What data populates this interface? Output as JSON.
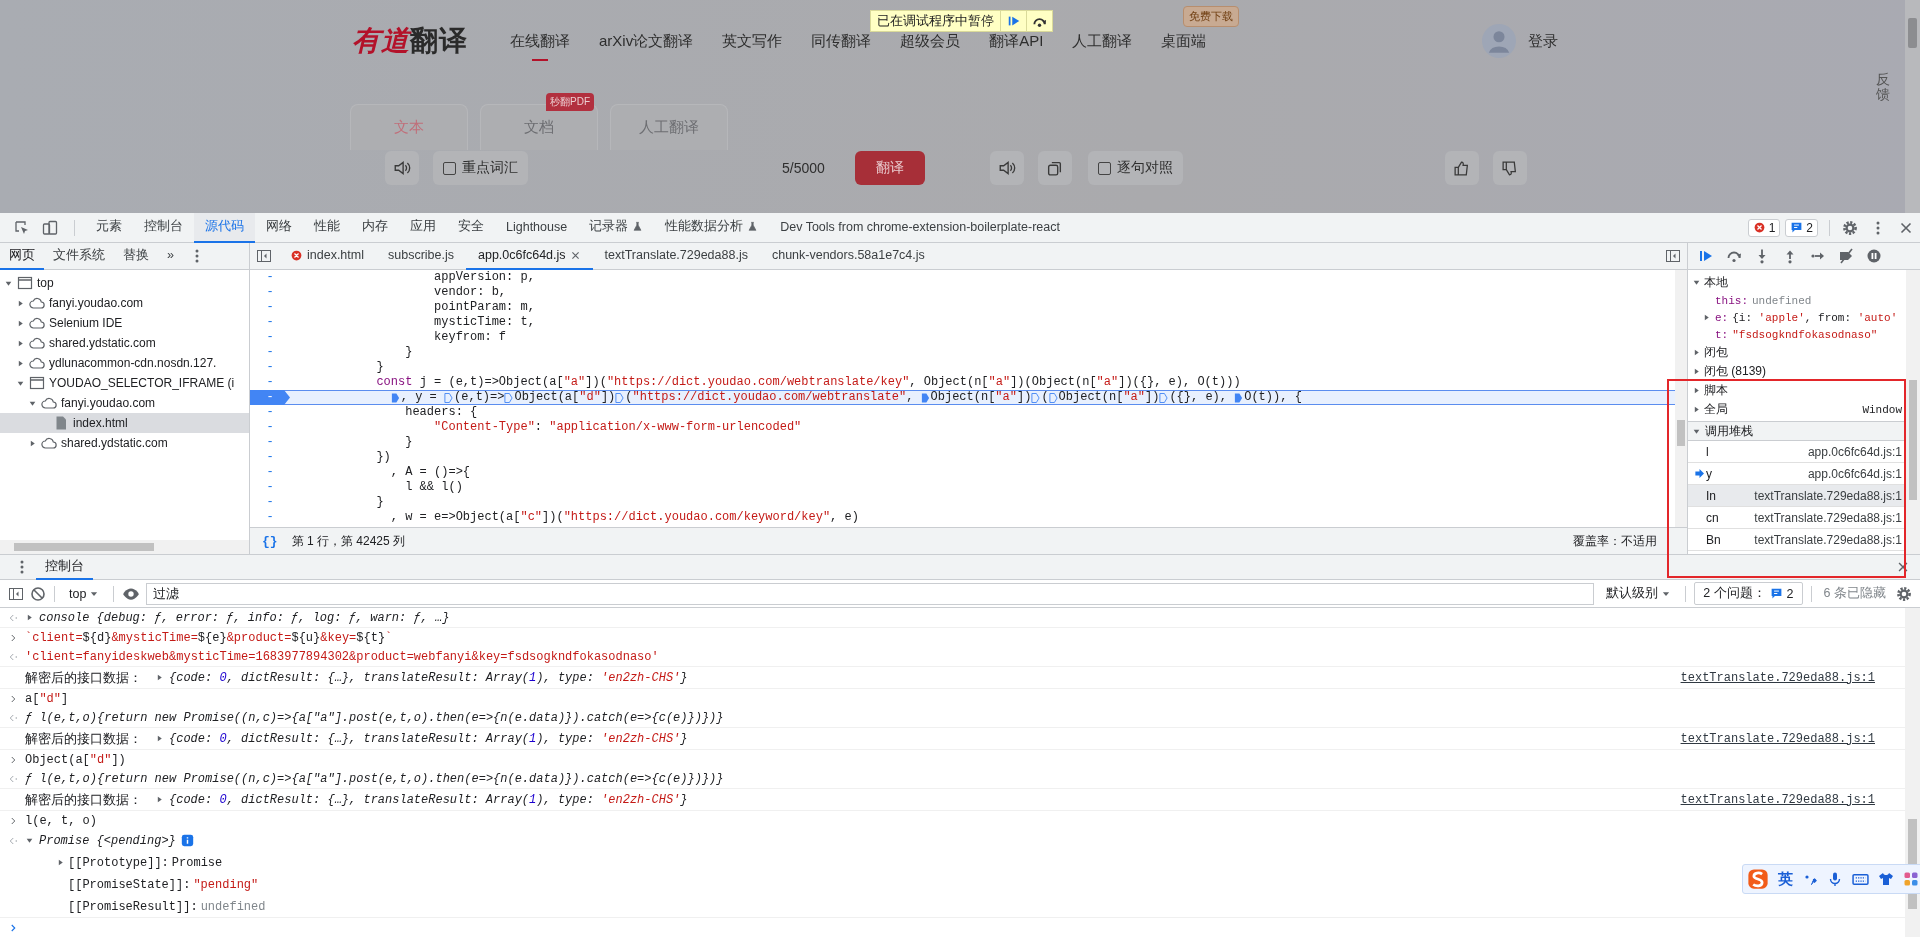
{
  "webpage": {
    "logo": {
      "brand": "有道",
      "word": "翻译"
    },
    "nav": [
      {
        "label": "在线翻译",
        "selected": true
      },
      {
        "label": "arXiv论文翻译",
        "selected": false
      },
      {
        "label": "英文写作",
        "selected": false
      },
      {
        "label": "同传翻译",
        "selected": false
      },
      {
        "label": "超级会员",
        "selected": false
      },
      {
        "label": "翻译API",
        "selected": false
      },
      {
        "label": "人工翻译",
        "selected": false
      },
      {
        "label": "桌面端",
        "selected": false,
        "badge": "免费下载"
      }
    ],
    "paused_banner": {
      "text": "已在调试程序中暂停"
    },
    "login": "登录",
    "feedback": "反馈",
    "mode_tabs": [
      {
        "label": "文本",
        "selected": true
      },
      {
        "label": "文档",
        "selected": false,
        "badge": "秒翻PDF"
      },
      {
        "label": "人工翻译",
        "selected": false
      }
    ],
    "toolbar": {
      "key_words": {
        "label": "重点词汇",
        "checked": false
      },
      "count": "5/5000",
      "translate_button": "翻译",
      "compare": {
        "label": "逐句对照",
        "checked": false
      }
    }
  },
  "devtools": {
    "tabs": [
      {
        "label": "元素",
        "selected": false,
        "experimental": false
      },
      {
        "label": "控制台",
        "selected": false,
        "experimental": false
      },
      {
        "label": "源代码",
        "selected": true,
        "experimental": false
      },
      {
        "label": "网络",
        "selected": false,
        "experimental": false
      },
      {
        "label": "性能",
        "selected": false,
        "experimental": false
      },
      {
        "label": "内存",
        "selected": false,
        "experimental": false
      },
      {
        "label": "应用",
        "selected": false,
        "experimental": false
      },
      {
        "label": "安全",
        "selected": false,
        "experimental": false
      },
      {
        "label": "Lighthouse",
        "selected": false,
        "experimental": false
      },
      {
        "label": "记录器",
        "selected": false,
        "experimental": true
      },
      {
        "label": "性能数据分析",
        "selected": false,
        "experimental": true
      },
      {
        "label": "Dev Tools from chrome-extension-boilerplate-react",
        "selected": false,
        "experimental": false
      }
    ],
    "counters": {
      "errors": "1",
      "issues": "2"
    },
    "navigator": {
      "tabs": [
        {
          "label": "网页",
          "selected": true
        },
        {
          "label": "文件系统",
          "selected": false
        },
        {
          "label": "替换",
          "selected": false
        }
      ],
      "more": "»",
      "tree": [
        {
          "label": "top",
          "kind": "frame",
          "expanded": true,
          "selected": false,
          "children": [
            {
              "label": "fanyi.youdao.com",
              "kind": "domain",
              "expanded": false,
              "selected": false
            },
            {
              "label": "Selenium IDE",
              "kind": "domain",
              "expanded": false,
              "selected": false
            },
            {
              "label": "shared.ydstatic.com",
              "kind": "domain",
              "expanded": false,
              "selected": false
            },
            {
              "label": "ydlunacommon-cdn.nosdn.127.",
              "kind": "domain",
              "expanded": false,
              "selected": false
            },
            {
              "label": "YOUDAO_SELECTOR_IFRAME (i",
              "kind": "frame",
              "expanded": true,
              "selected": false,
              "children": [
                {
                  "label": "fanyi.youdao.com",
                  "kind": "domain",
                  "expanded": true,
                  "selected": false,
                  "children": [
                    {
                      "label": "index.html",
                      "kind": "file",
                      "selected": true
                    }
                  ]
                },
                {
                  "label": "shared.ydstatic.com",
                  "kind": "domain",
                  "expanded": false,
                  "selected": false
                }
              ]
            }
          ]
        }
      ]
    },
    "editor": {
      "tabs": [
        {
          "label": "index.html",
          "selected": false,
          "error": true
        },
        {
          "label": "subscribe.js",
          "selected": false,
          "error": false
        },
        {
          "label": "app.0c6fc64d.js",
          "selected": true,
          "error": false
        },
        {
          "label": "textTranslate.729eda88.js",
          "selected": false,
          "error": false
        },
        {
          "label": "chunk-vendors.58a1e7c4.js",
          "selected": false,
          "error": false
        }
      ],
      "lines": [
        {
          "gutter": "-",
          "paused": false,
          "parts": [
            {
              "text": "                    appVersion: p,"
            }
          ]
        },
        {
          "gutter": "-",
          "paused": false,
          "parts": [
            {
              "text": "                    vendor: b,"
            }
          ]
        },
        {
          "gutter": "-",
          "paused": false,
          "parts": [
            {
              "text": "                    pointParam: m,"
            }
          ]
        },
        {
          "gutter": "-",
          "paused": false,
          "parts": [
            {
              "text": "                    mysticTime: t,"
            }
          ]
        },
        {
          "gutter": "-",
          "paused": false,
          "parts": [
            {
              "text": "                    keyfrom: f"
            }
          ]
        },
        {
          "gutter": "-",
          "paused": false,
          "parts": [
            {
              "text": "                }"
            }
          ]
        },
        {
          "gutter": "-",
          "paused": false,
          "parts": [
            {
              "text": "            }"
            }
          ]
        },
        {
          "gutter": "-",
          "paused": false,
          "parts": [
            {
              "text": "            const j = (e,t)=>Object(a[\"a\"])(\"https://dict.youdao.com/webtranslate/key\", Object(n[\"a\"])(Object(n[\"a\"])({}, e), O(t)))"
            }
          ]
        },
        {
          "gutter": "-",
          "paused": true,
          "parts": [
            {
              "kind": "solid",
              "text": ", y = "
            },
            {
              "kind": "hollow",
              "text": "(e,t)=>"
            },
            {
              "kind": "hollow",
              "text": "Object(a[\"d\"])"
            },
            {
              "kind": "hollow",
              "text": "(\"https://dict.youdao.com/webtranslate\", "
            },
            {
              "kind": "solid",
              "text": "Object(n[\"a\"])"
            },
            {
              "kind": "hollow",
              "text": "("
            },
            {
              "kind": "hollow",
              "text": "Object(n[\"a\"])"
            },
            {
              "kind": "hollow",
              "text": "({}, e), "
            },
            {
              "kind": "solid",
              "text": "O(t)), {"
            }
          ]
        },
        {
          "gutter": "-",
          "paused": false,
          "parts": [
            {
              "text": "                headers: {"
            }
          ]
        },
        {
          "gutter": "-",
          "paused": false,
          "parts": [
            {
              "text": "                    \"Content-Type\": \"application/x-www-form-urlencoded\""
            }
          ]
        },
        {
          "gutter": "-",
          "paused": false,
          "parts": [
            {
              "text": "                }"
            }
          ]
        },
        {
          "gutter": "-",
          "paused": false,
          "parts": [
            {
              "text": "            })"
            }
          ]
        },
        {
          "gutter": "-",
          "paused": false,
          "parts": [
            {
              "text": "              , A = ()=>{"
            }
          ]
        },
        {
          "gutter": "-",
          "paused": false,
          "parts": [
            {
              "text": "                l && l()"
            }
          ]
        },
        {
          "gutter": "-",
          "paused": false,
          "parts": [
            {
              "text": "            }"
            }
          ]
        },
        {
          "gutter": "-",
          "paused": false,
          "parts": [
            {
              "text": "              , w = e=>Object(a[\"c\"])(\"https://dict.youdao.com/keyword/key\", e)"
            }
          ]
        }
      ],
      "format_button": "{}",
      "status": {
        "position": "第 1 行，第 42425 列",
        "coverage": "覆盖率：不适用"
      }
    },
    "debugger": {
      "scope": [
        {
          "label": "本地",
          "expanded": true,
          "vars": [
            {
              "name": "this:",
              "value": "undefined",
              "kind": "undefined"
            },
            {
              "name": "e:",
              "value": "{i: 'apple', from: 'auto'",
              "kind": "object",
              "expanded": false
            },
            {
              "name": "t:",
              "value": "\"fsdsogkndfokasodnaso\"",
              "kind": "string"
            }
          ]
        },
        {
          "label": "闭包",
          "expanded": false
        },
        {
          "label": "闭包 (8139)",
          "expanded": false
        },
        {
          "label": "脚本",
          "expanded": false
        },
        {
          "label": "全局",
          "expanded": false,
          "value": "Window"
        }
      ],
      "call_stack": {
        "title": "调用堆栈",
        "expanded": true,
        "frames": [
          {
            "name": "l",
            "location": "app.0c6fc64d.js:1",
            "current": false,
            "highlighted": false
          },
          {
            "name": "y",
            "location": "app.0c6fc64d.js:1",
            "current": true,
            "highlighted": false
          },
          {
            "name": "In",
            "location": "textTranslate.729eda88.js:1",
            "current": false,
            "highlighted": true
          },
          {
            "name": "cn",
            "location": "textTranslate.729eda88.js:1",
            "current": false,
            "highlighted": false
          },
          {
            "name": "Bn",
            "location": "textTranslate.729eda88.js:1",
            "current": false,
            "highlighted": false
          }
        ]
      }
    }
  },
  "drawer": {
    "tabs": [
      {
        "label": "控制台",
        "selected": true
      }
    ],
    "console": {
      "context": "top",
      "filter_placeholder": "过滤",
      "level": "默认级别",
      "issues_label": "2 个问题：",
      "issues_count": "2",
      "hidden": "6 条已隐藏",
      "messages": [
        {
          "kind": "object_result",
          "expanded": false,
          "text": "console {debug: ƒ, error: ƒ, info: ƒ, log: ƒ, warn: ƒ, …}"
        },
        {
          "kind": "input",
          "text": "`client=${d}&mysticTime=${e}&product=${u}&key=${t}`"
        },
        {
          "kind": "string_result",
          "text": "'client=fanyideskweb&mysticTime=1683977894302&product=webfanyi&key=fsdsogkndfokasodnaso'"
        },
        {
          "kind": "log",
          "label": "解密后的接口数据：",
          "expanded": false,
          "text": "{code: 0, dictResult: {…}, translateResult: Array(1), type: 'en2zh-CHS'}",
          "source": "textTranslate.729eda88.js:1"
        },
        {
          "kind": "input",
          "text": "a[\"d\"]"
        },
        {
          "kind": "function_result",
          "text": "ƒ l(e,t,o){return new Promise((n,c)=>{a[\"a\"].post(e,t,o).then(e=>{n(e.data)}).catch(e=>{c(e)})})}"
        },
        {
          "kind": "log",
          "label": "解密后的接口数据：",
          "expanded": false,
          "text": "{code: 0, dictResult: {…}, translateResult: Array(1), type: 'en2zh-CHS'}",
          "source": "textTranslate.729eda88.js:1"
        },
        {
          "kind": "input",
          "text": "Object(a[\"d\"])"
        },
        {
          "kind": "function_result",
          "text": "ƒ l(e,t,o){return new Promise((n,c)=>{a[\"a\"].post(e,t,o).then(e=>{n(e.data)}).catch(e=>{c(e)})})}"
        },
        {
          "kind": "log",
          "label": "解密后的接口数据：",
          "expanded": false,
          "text": "{code: 0, dictResult: {…}, translateResult: Array(1), type: 'en2zh-CHS'}",
          "source": "textTranslate.729eda88.js:1"
        },
        {
          "kind": "input",
          "text": "l(e, t, o)"
        },
        {
          "kind": "object",
          "expanded": true,
          "info": true,
          "text": "Promise {<pending>}",
          "children": [
            {
              "key": "[[Prototype]]:",
              "value": "Promise",
              "kind": "plain",
              "expanded": false
            },
            {
              "key": "[[PromiseState]]:",
              "value": "\"pending\"",
              "kind": "string"
            },
            {
              "key": "[[PromiseResult]]:",
              "value": "undefined",
              "kind": "undefined"
            }
          ]
        },
        {
          "kind": "prompt"
        }
      ]
    }
  },
  "ime": {
    "mode": "英"
  }
}
